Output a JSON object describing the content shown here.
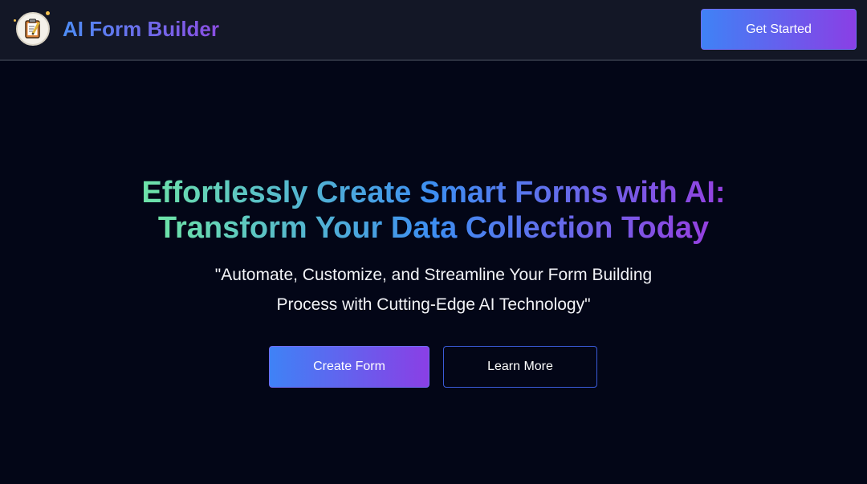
{
  "header": {
    "brand": "AI Form Builder",
    "logo_icon": "clipboard-pencil-icon",
    "cta_label": "Get Started"
  },
  "hero": {
    "headline_line1": "Effortlessly Create Smart Forms with AI:",
    "headline_line2": "Transform Your Data Collection Today",
    "subtitle": "\"Automate, Customize, and Streamline Your Form Building Process with Cutting-Edge AI Technology\"",
    "primary_button": "Create Form",
    "secondary_button": "Learn More"
  },
  "colors": {
    "background": "#030617",
    "header_background": "#131726",
    "gradient_start": "#3f82f6",
    "gradient_end": "#8a3fe5",
    "headline_gradient_start": "#6ee4a8",
    "outline_border": "#3a5bd9"
  }
}
